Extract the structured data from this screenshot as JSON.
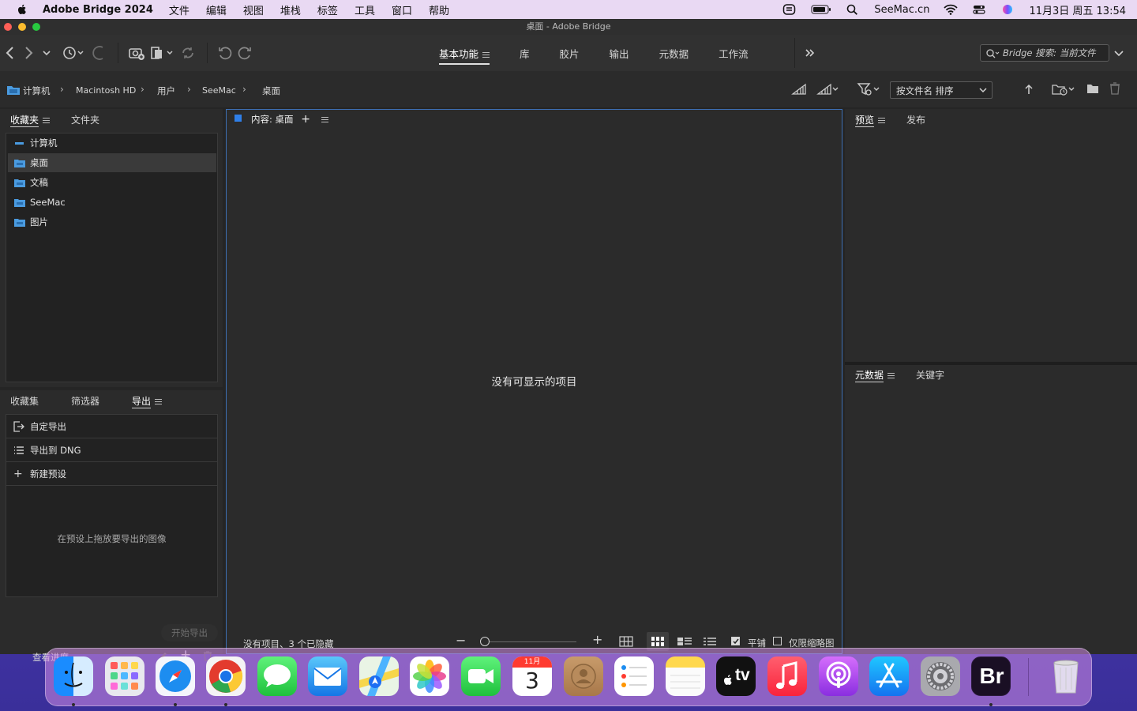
{
  "menubar": {
    "app_name": "Adobe Bridge 2024",
    "items": [
      "文件",
      "编辑",
      "视图",
      "堆栈",
      "标签",
      "工具",
      "窗口",
      "帮助"
    ],
    "site": "SeeMac.cn",
    "datetime": "11月3日 周五 13:54"
  },
  "window": {
    "title": "桌面 - Adobe Bridge"
  },
  "toolbar": {
    "workspaces": [
      "基本功能",
      "库",
      "胶片",
      "输出",
      "元数据",
      "工作流"
    ],
    "active_workspace": 0,
    "search_placeholder": "Bridge 搜索: 当前文件"
  },
  "pathbar": {
    "crumbs": [
      "计算机",
      "Macintosh HD",
      "用户",
      "SeeMac",
      "桌面"
    ],
    "sort_label": "按文件名 排序"
  },
  "left_top": {
    "tabs": [
      "收藏夹",
      "文件夹"
    ],
    "favorites": [
      "计算机",
      "桌面",
      "文稿",
      "SeeMac",
      "图片"
    ],
    "selected": 1
  },
  "left_bottom": {
    "tabs": [
      "收藏集",
      "筛选器",
      "导出"
    ],
    "active_tab": 2,
    "export_items": [
      "自定导出",
      "导出到 DNG",
      "新建预设"
    ],
    "drop_hint": "在预设上拖放要导出的图像",
    "start_export": "开始导出",
    "view_progress": "查看进度"
  },
  "content": {
    "tab_label": "内容: 桌面",
    "empty_message": "没有可显示的项目",
    "status": "没有项目、3 个已隐藏",
    "tile_label": "平铺",
    "thumbs_only_label": "仅限缩略图",
    "tile_checked": true,
    "thumbs_only_checked": false
  },
  "right_top": {
    "tabs": [
      "预览",
      "发布"
    ]
  },
  "right_bottom": {
    "tabs": [
      "元数据",
      "关键字"
    ]
  },
  "dock": {
    "month": "11月",
    "day": "3",
    "tv_label": "tv",
    "bridge_label": "Br"
  }
}
